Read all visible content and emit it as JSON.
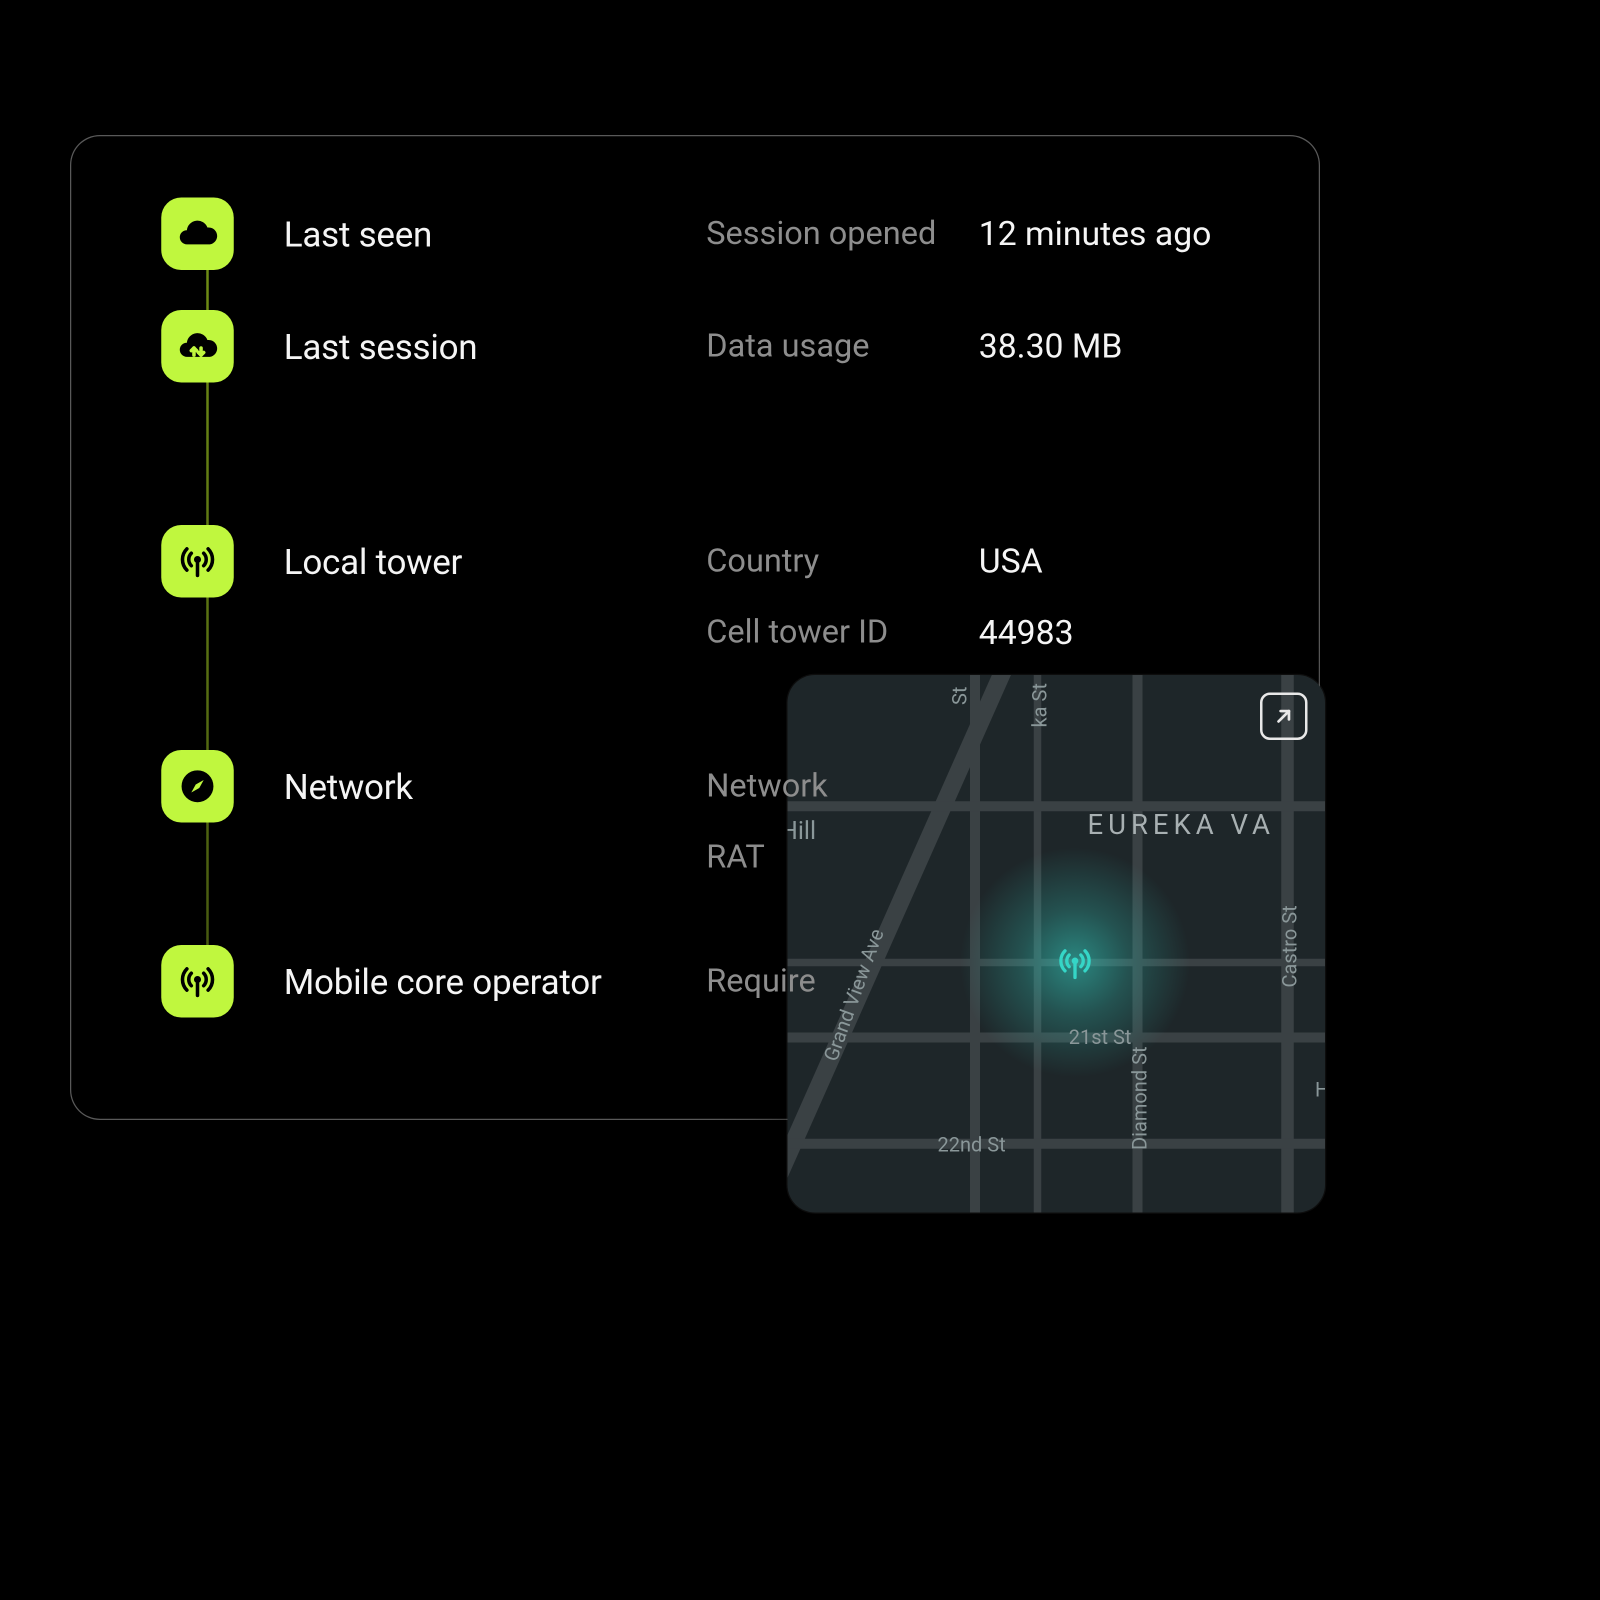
{
  "colors": {
    "accent": "#C0F73E",
    "text_muted": "#8d8d8d",
    "map_glow": "#35d6c7"
  },
  "rows": [
    {
      "icon": "cloud-icon",
      "label": "Last seen",
      "lines": [
        {
          "key": "Session opened",
          "value": "12 minutes ago"
        }
      ]
    },
    {
      "icon": "cloud-sync-icon",
      "label": "Last session",
      "lines": [
        {
          "key": "Data usage",
          "value": "38.30 MB"
        }
      ]
    },
    {
      "icon": "antenna-icon",
      "label": "Local tower",
      "lines": [
        {
          "key": "Country",
          "value": "USA"
        },
        {
          "key": "Cell tower ID",
          "value": "44983"
        }
      ]
    },
    {
      "icon": "compass-icon",
      "label": "Network",
      "lines": [
        {
          "key": "Network",
          "value": ""
        },
        {
          "key": "RAT",
          "value": ""
        }
      ]
    },
    {
      "icon": "antenna-icon",
      "label": "Mobile core operator",
      "lines": [
        {
          "key": "Require",
          "value": ""
        }
      ]
    }
  ],
  "map": {
    "district": "EUREKA VA",
    "neighborhood": "Hill",
    "streets": {
      "grand_view": "Grand View Ave",
      "twentyfirst": "21st St",
      "twentysecond": "22nd St",
      "diamond": "Diamond St",
      "castro": "Castro St",
      "eureka_st": "ka St",
      "st_short": "St"
    },
    "expand_label": "Open map"
  }
}
